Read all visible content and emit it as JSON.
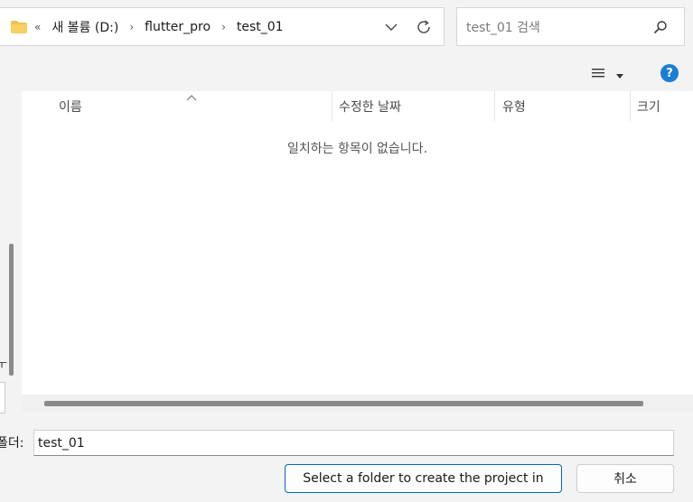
{
  "address": {
    "back_chevrons": "«",
    "breadcrumbs": [
      "새 볼륨 (D:)",
      "flutter_pro",
      "test_01"
    ],
    "separator": "›"
  },
  "search": {
    "placeholder": "test_01 검색"
  },
  "toolbar": {
    "help_label": "?"
  },
  "file_list": {
    "columns": [
      "이름",
      "수정한 날짜",
      "유형",
      "크기"
    ],
    "empty_message": "일치하는 항목이 없습니다."
  },
  "nav_pane": {
    "partial_text": "ㅜ"
  },
  "footer": {
    "folder_label": "폴더:",
    "folder_value": "test_01",
    "select_button": "Select a folder to create the project in",
    "cancel_button": "취소"
  },
  "colors": {
    "accent": "#0067c0",
    "help": "#1a7fd4",
    "folder": "#f2c14e"
  }
}
